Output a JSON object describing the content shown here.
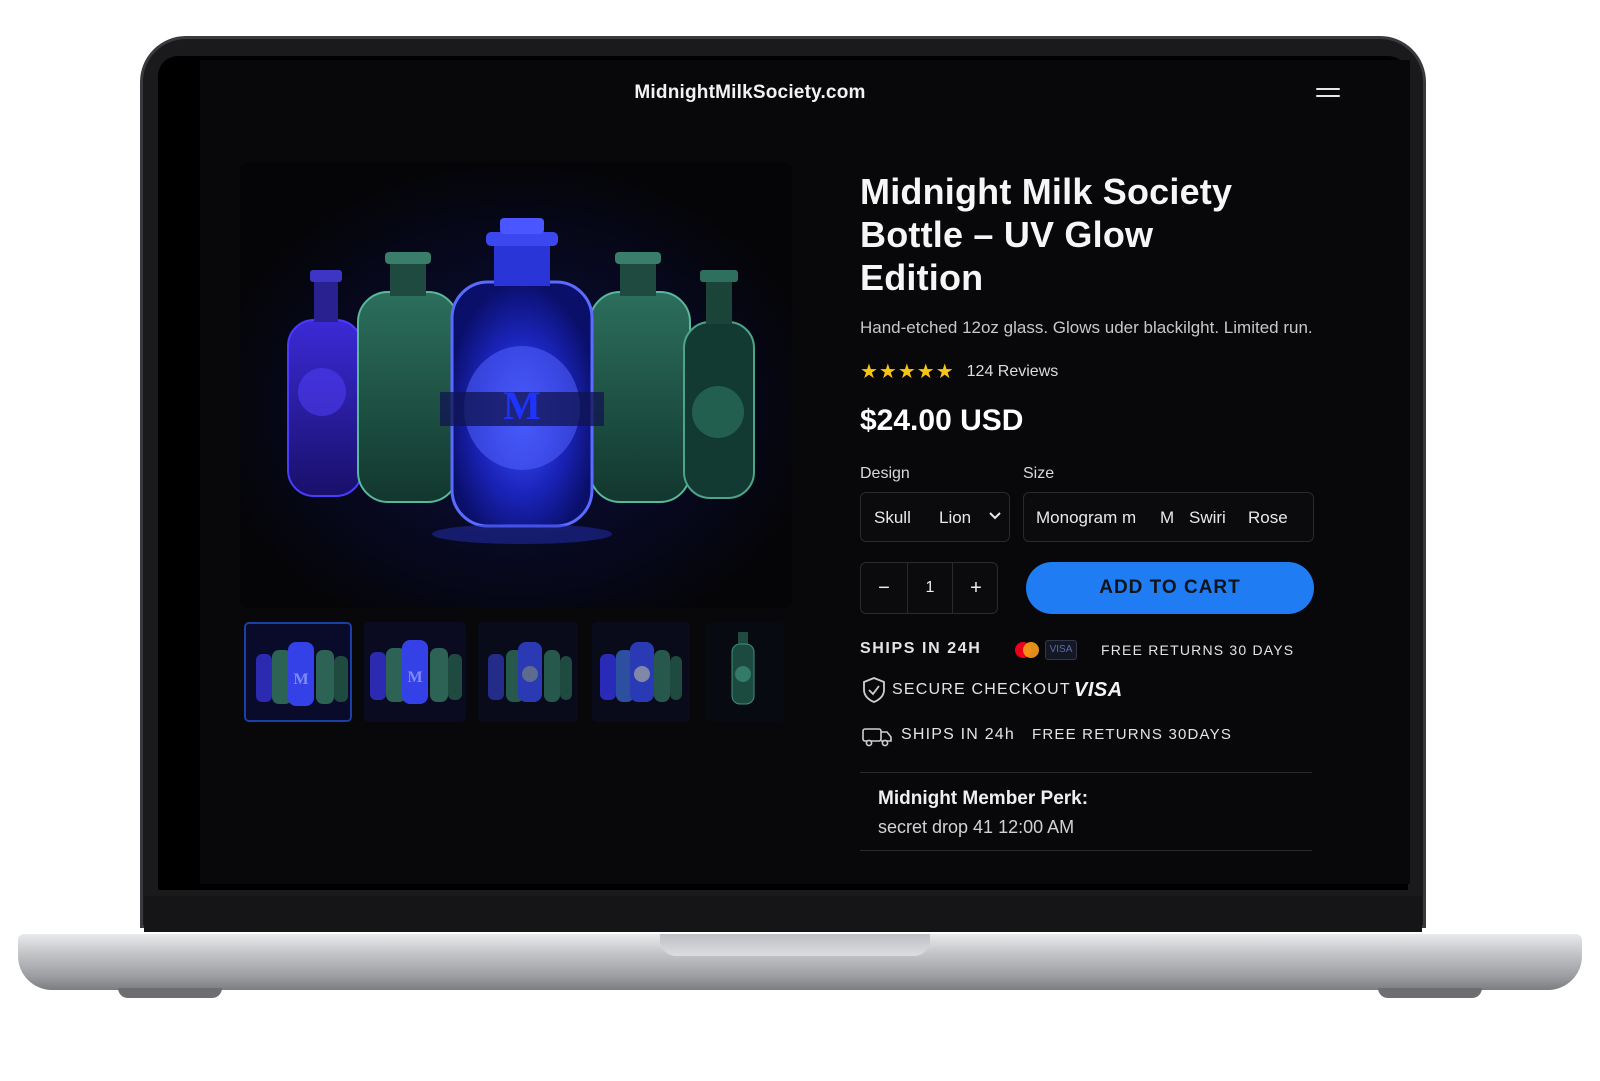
{
  "header": {
    "site_title": "MidnightMilkSociety.com",
    "menu_icon": "hamburger-menu-icon"
  },
  "gallery": {
    "main_image": "uv-glow-bottles-image",
    "monogram": "M",
    "thumbnails": [
      {
        "name": "thumbnail-1",
        "active": true
      },
      {
        "name": "thumbnail-2",
        "active": false
      },
      {
        "name": "thumbnail-3",
        "active": false
      },
      {
        "name": "thumbnail-4",
        "active": false
      },
      {
        "name": "thumbnail-5",
        "active": false
      }
    ]
  },
  "product": {
    "title_line1": "Midnight Milk Society",
    "title_line2": "Bottle – UV Glow",
    "title_line3": "Edition",
    "description": "Hand-etched 12oz glass. Glows uder blackilght. Limited run.",
    "stars": "★★★★★",
    "reviews": "124 Reviews",
    "price": "$24.00 USD"
  },
  "options": {
    "design_label": "Design",
    "size_label": "Size",
    "design_options": [
      "Skull",
      "Lion"
    ],
    "size_options": [
      "Monogram m",
      "M",
      "Swiri",
      "Rose"
    ]
  },
  "purchase": {
    "quantity": "1",
    "minus": "−",
    "plus": "+",
    "add_to_cart": "ADD TO CART"
  },
  "badges": {
    "ships_24h": "SHIPS IN 24H",
    "visa_small": "VISA",
    "free_returns": "FREE RETURNS 30 DAYS",
    "secure_checkout": "SECURE CHECKOUT",
    "visa_large": "VISA",
    "ships_24h_lower": "SHIPS IN 24h",
    "free_returns_lower": "FREE  RETURNS 30DAYS"
  },
  "perk": {
    "title": "Midnight Member Perk:",
    "text": "secret drop 41 12:00 AM"
  },
  "colors": {
    "accent": "#1f7cf2",
    "background": "#08080a",
    "star": "#f7c515",
    "mastercard_red": "#eb001b",
    "mastercard_orange": "#f79e1b"
  }
}
